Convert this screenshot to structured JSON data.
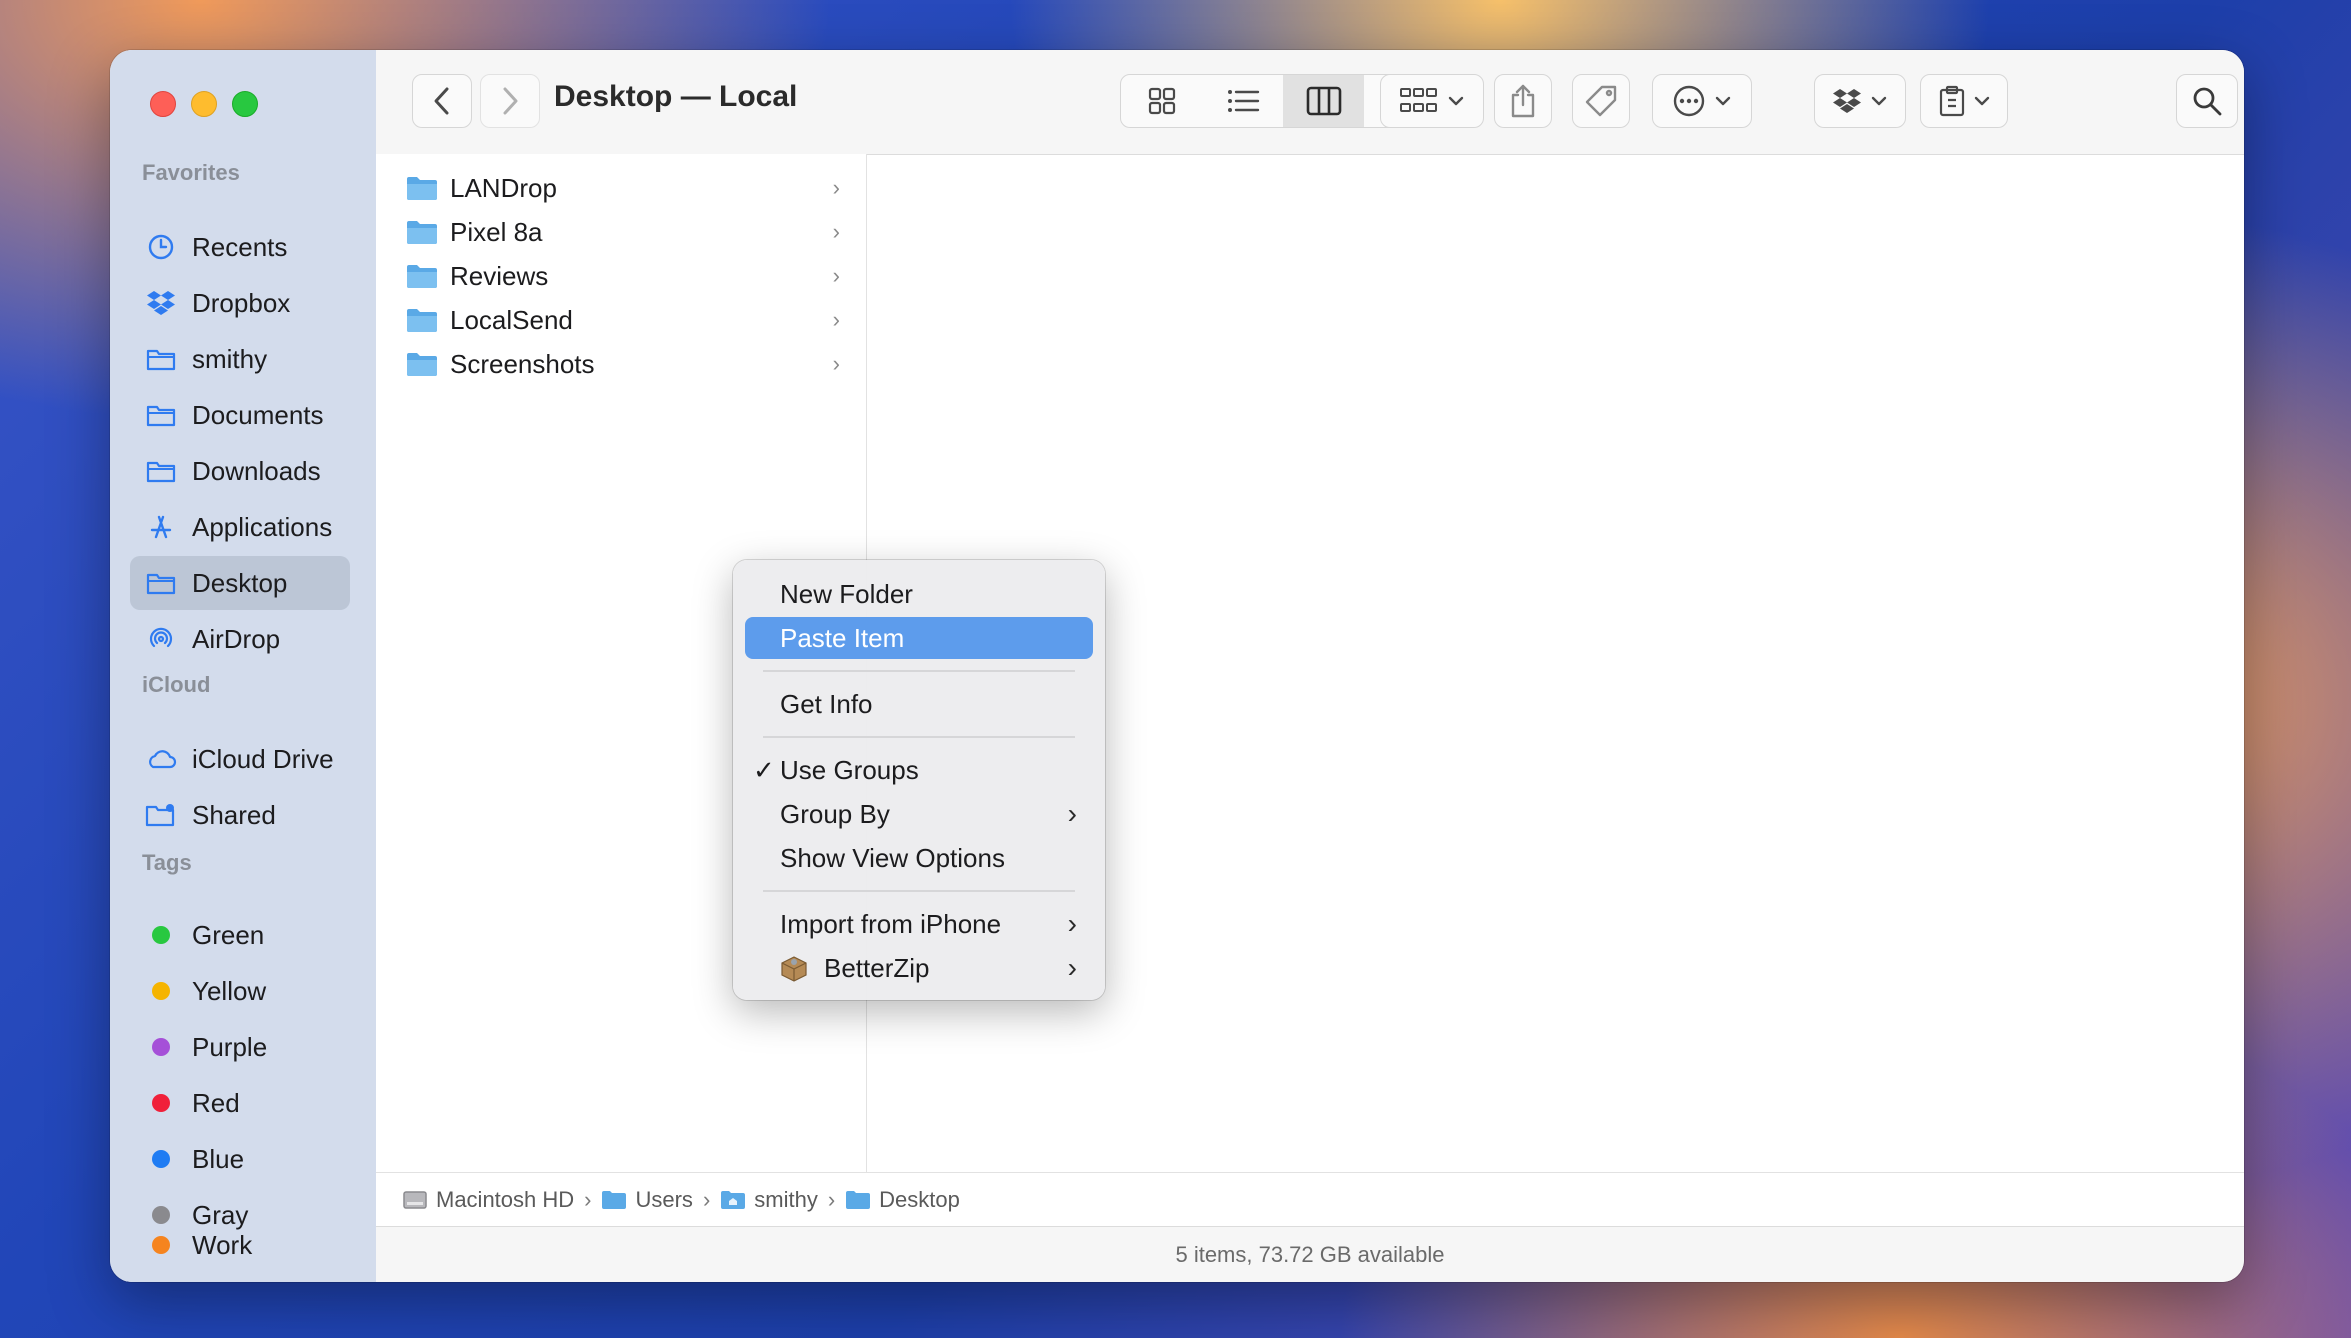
{
  "window": {
    "title": "Desktop — Local"
  },
  "sidebar": {
    "favorites_header": "Favorites",
    "favorites": [
      {
        "label": "Recents",
        "icon": "clock-icon"
      },
      {
        "label": "Dropbox",
        "icon": "dropbox-icon"
      },
      {
        "label": "smithy",
        "icon": "folder-icon"
      },
      {
        "label": "Documents",
        "icon": "folder-icon"
      },
      {
        "label": "Downloads",
        "icon": "folder-icon"
      },
      {
        "label": "Applications",
        "icon": "applications-icon"
      },
      {
        "label": "Desktop",
        "icon": "folder-icon",
        "active": true
      },
      {
        "label": "AirDrop",
        "icon": "airdrop-icon"
      }
    ],
    "icloud_header": "iCloud",
    "icloud": [
      {
        "label": "iCloud Drive",
        "icon": "cloud-icon"
      },
      {
        "label": "Shared",
        "icon": "shared-folder-icon"
      }
    ],
    "tags_header": "Tags",
    "tags": [
      {
        "label": "Green",
        "color": "#28c840"
      },
      {
        "label": "Yellow",
        "color": "#f5b400"
      },
      {
        "label": "Purple",
        "color": "#a550d8"
      },
      {
        "label": "Red",
        "color": "#f0203a"
      },
      {
        "label": "Blue",
        "color": "#1f7cf3"
      },
      {
        "label": "Gray",
        "color": "#8a8a8e"
      },
      {
        "label": "Work",
        "color": "#f5841f"
      }
    ]
  },
  "files": [
    {
      "name": "LANDrop"
    },
    {
      "name": "Pixel 8a"
    },
    {
      "name": "Reviews"
    },
    {
      "name": "LocalSend"
    },
    {
      "name": "Screenshots"
    }
  ],
  "context_menu": {
    "new_folder": "New Folder",
    "paste_item": "Paste Item",
    "get_info": "Get Info",
    "use_groups": "Use Groups",
    "use_groups_check": "✓",
    "group_by": "Group By",
    "show_view_options": "Show View Options",
    "import_from_iphone": "Import from iPhone",
    "betterzip": "BetterZip",
    "arrow": "›"
  },
  "path": {
    "macintosh_hd": "Macintosh HD",
    "users": "Users",
    "smithy": "smithy",
    "desktop": "Desktop",
    "sep": "›"
  },
  "status": {
    "text": "5 items, 73.72 GB available"
  },
  "colors": {
    "accent": "#5d9cec",
    "folder": "#5aa9e6"
  }
}
